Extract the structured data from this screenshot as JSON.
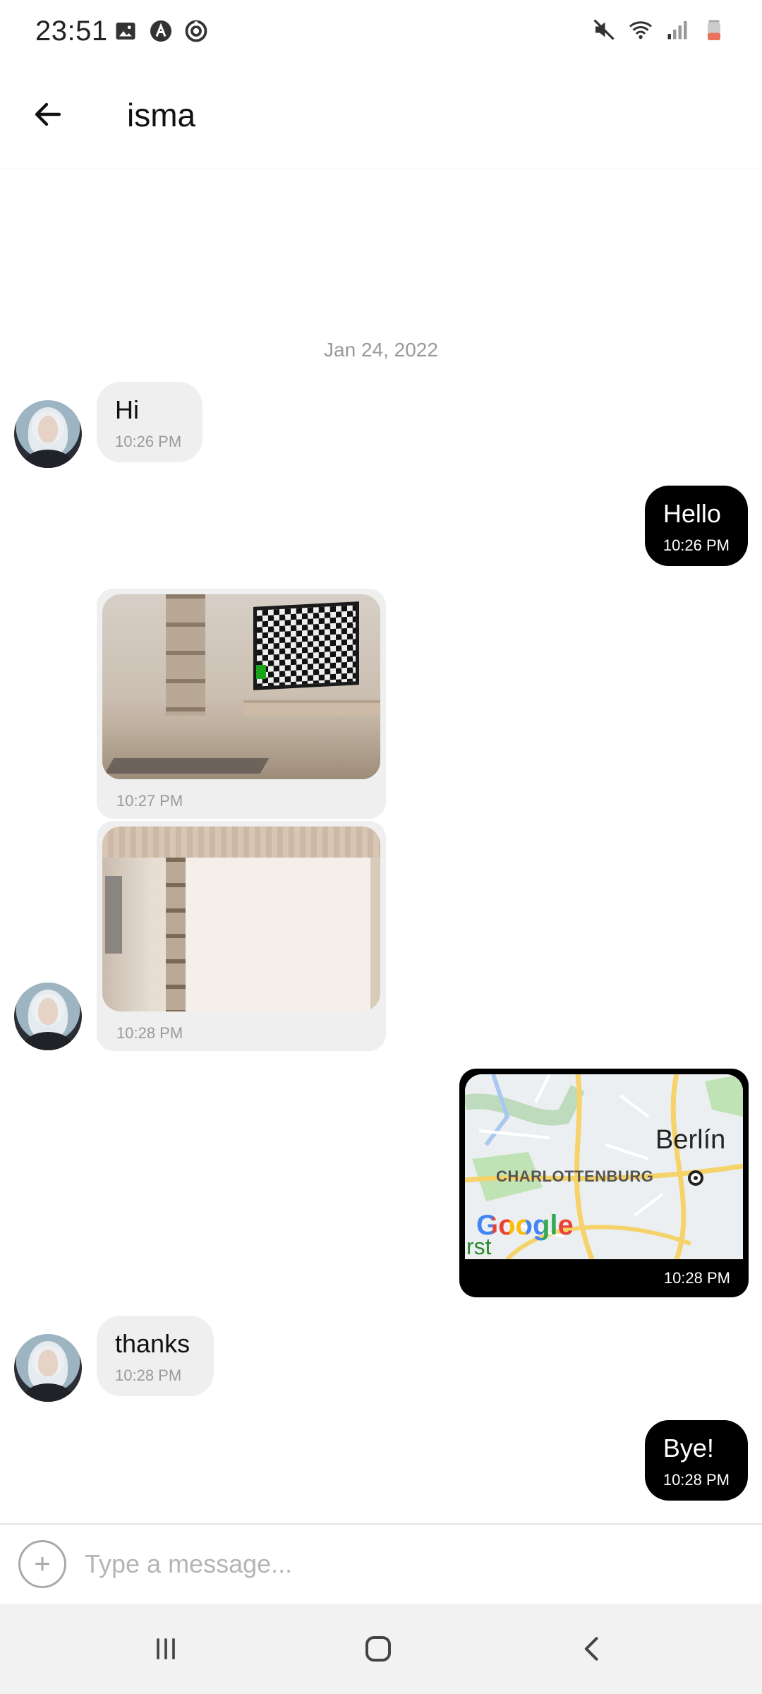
{
  "status_bar": {
    "time": "23:51",
    "left_icons": [
      "image-icon",
      "app-icon",
      "sync-icon"
    ],
    "right_icons": [
      "mute-icon",
      "wifi-icon",
      "signal-icon",
      "battery-low-icon"
    ]
  },
  "header": {
    "title": "isma",
    "back_icon": "arrow-left-icon"
  },
  "chat": {
    "date_separator": "Jan 24, 2022",
    "messages": [
      {
        "direction": "incoming",
        "type": "text",
        "text": "Hi",
        "time": "10:26 PM"
      },
      {
        "direction": "outgoing",
        "type": "text",
        "text": "Hello",
        "time": "10:26 PM"
      },
      {
        "direction": "incoming",
        "type": "image",
        "image": "room-with-tv-photo",
        "time": "10:27 PM"
      },
      {
        "direction": "incoming",
        "type": "image",
        "image": "white-wall-room-photo",
        "time": "10:28 PM"
      },
      {
        "direction": "outgoing",
        "type": "location",
        "map": {
          "city": "Berlín",
          "district": "CHARLOTTENBURG",
          "logo": "Google",
          "edge_text": "rst"
        },
        "time": "10:28 PM"
      },
      {
        "direction": "incoming",
        "type": "text",
        "text": "thanks",
        "time": "10:28 PM"
      },
      {
        "direction": "outgoing",
        "type": "text",
        "text": "Bye!",
        "time": "10:28 PM"
      }
    ]
  },
  "composer": {
    "add_symbol": "+",
    "placeholder": "Type a message..."
  },
  "navbar": {
    "buttons": [
      "recent-apps-icon",
      "home-icon",
      "back-icon"
    ]
  },
  "colors": {
    "outgoing_bubble": "#000000",
    "incoming_bubble": "#efefef",
    "timestamp_gray": "#9a9a9a",
    "navbar_bg": "#f2f2f2"
  }
}
